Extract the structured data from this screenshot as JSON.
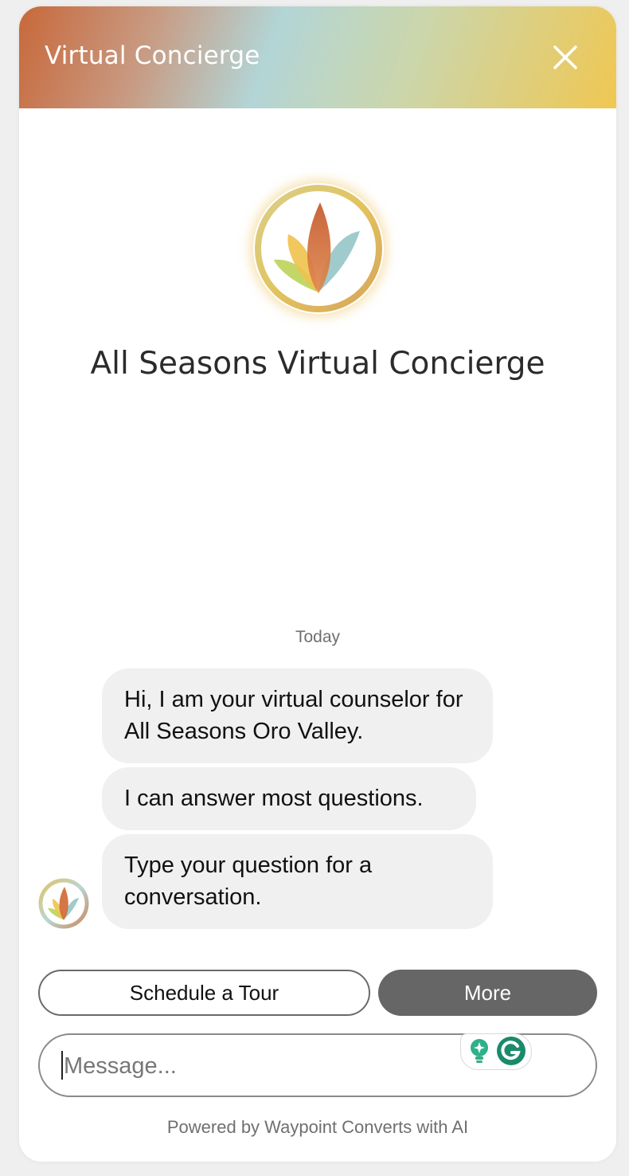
{
  "header": {
    "title": "Virtual Concierge",
    "close_icon": "close-icon"
  },
  "brand": {
    "logo_icon": "lotus-logo-icon",
    "title": "All Seasons Virtual Concierge"
  },
  "chat": {
    "date_label": "Today",
    "messages": [
      {
        "text": "Hi, I am your virtual counselor for All Seasons Oro Valley."
      },
      {
        "text": "I can answer most questions."
      },
      {
        "text": "Type your question for a conversation."
      }
    ],
    "avatar_icon": "lotus-avatar-icon"
  },
  "actions": {
    "schedule_label": "Schedule a Tour",
    "more_label": "More"
  },
  "composer": {
    "placeholder": "Message...",
    "value": "",
    "extension_icons": [
      "lightbulb-icon",
      "grammarly-g-icon"
    ]
  },
  "footer": {
    "text": "Powered by Waypoint Converts with AI"
  },
  "colors": {
    "header_gradient": [
      "#c8683a",
      "#b3d5d6",
      "#f0c752"
    ],
    "bubble_bg": "#f0f0f0",
    "more_button_bg": "#666666"
  }
}
